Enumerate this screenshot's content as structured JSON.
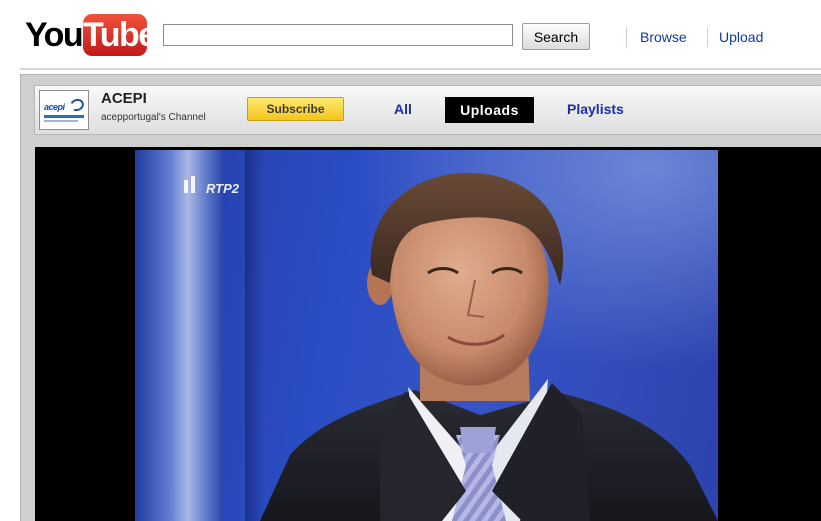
{
  "header": {
    "logo": {
      "part1": "You",
      "part2": "Tube"
    },
    "search": {
      "value": "",
      "placeholder": "",
      "button_label": "Search"
    },
    "links": [
      {
        "label": "Browse"
      },
      {
        "label": "Upload"
      }
    ]
  },
  "channel": {
    "thumbnail_text": "acepi",
    "name": "ACEPI",
    "subtitle": "acepportugal's Channel",
    "subscribe_label": "Subscribe",
    "tabs": [
      {
        "label": "All",
        "active": false
      },
      {
        "label": "Uploads",
        "active": true
      },
      {
        "label": "Playlists",
        "active": false
      }
    ]
  },
  "player": {
    "station_logo": "RTP2"
  },
  "colors": {
    "link": "#0b3aa8",
    "tab": "#1a2fa3",
    "subscribe": "#f4c51b",
    "logo_red": "#d9262a",
    "video_background": "#2b4dc4"
  },
  "icons": {
    "logo": "youtube-logo",
    "channel_thumbnail": "acepi-logo",
    "station": "rtp2-logo"
  }
}
